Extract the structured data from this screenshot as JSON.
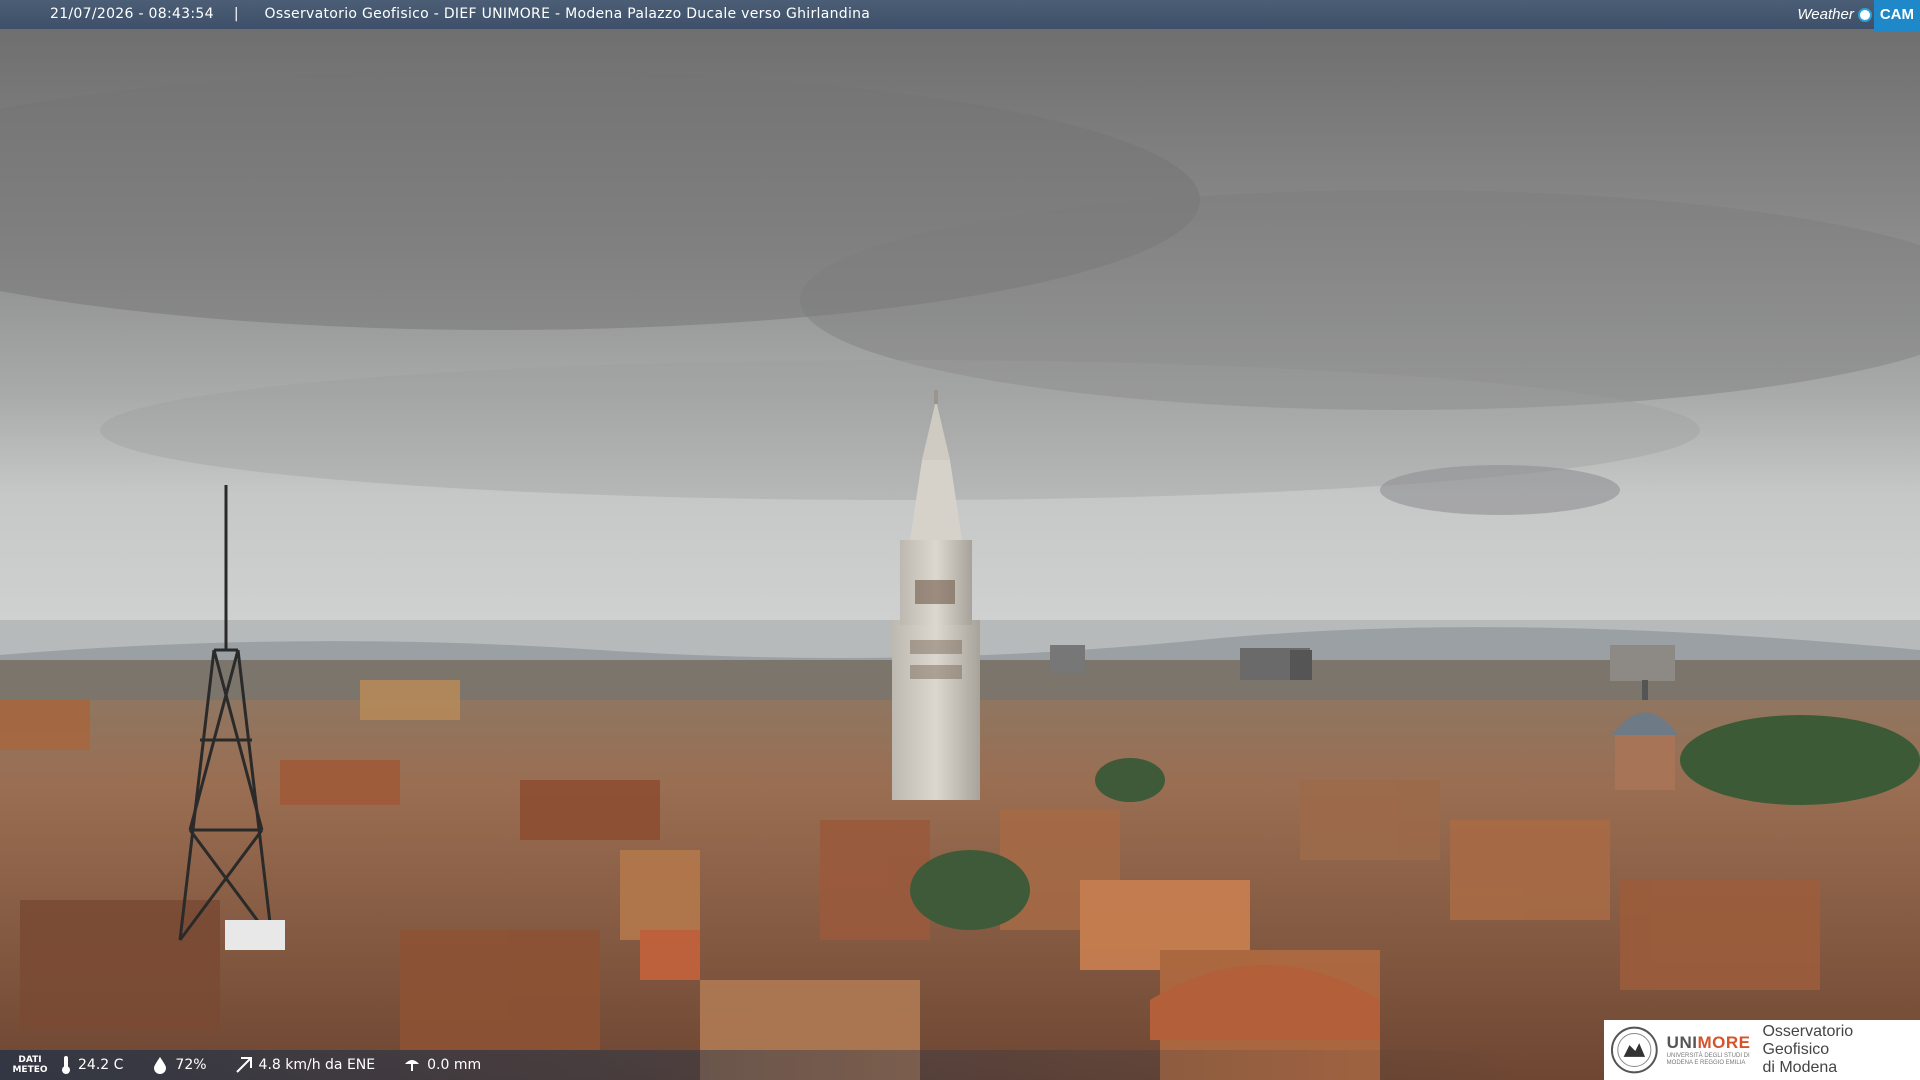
{
  "overlay": {
    "timestamp": "21/07/2026 - 08:43:54",
    "separator": "|",
    "title": "Osservatorio Geofisico - DIEF UNIMORE - Modena Palazzo Ducale verso Ghirlandina",
    "brand_weather": "Weather",
    "brand_cam": "CAM"
  },
  "weather": {
    "label_line1": "DATI",
    "label_line2": "METEO",
    "temperature": "24.2 C",
    "humidity": "72%",
    "wind": "4.8 km/h da ENE",
    "rain": "0.0 mm",
    "icons": [
      "thermometer-icon",
      "humidity-icon",
      "wind-icon",
      "rain-icon"
    ]
  },
  "logo": {
    "uni_part1": "UNI",
    "uni_part2": "MORE",
    "uni_sub_line1": "UNIVERSITÀ DEGLI STUDI DI",
    "uni_sub_line2": "MODENA E REGGIO EMILIA",
    "obs_line1": "Osservatorio Geofisico",
    "obs_line2": "di Modena"
  },
  "colors": {
    "topbar": "#42546c",
    "brand_accent": "#1e88c8",
    "unimore_accent": "#d5542a"
  }
}
